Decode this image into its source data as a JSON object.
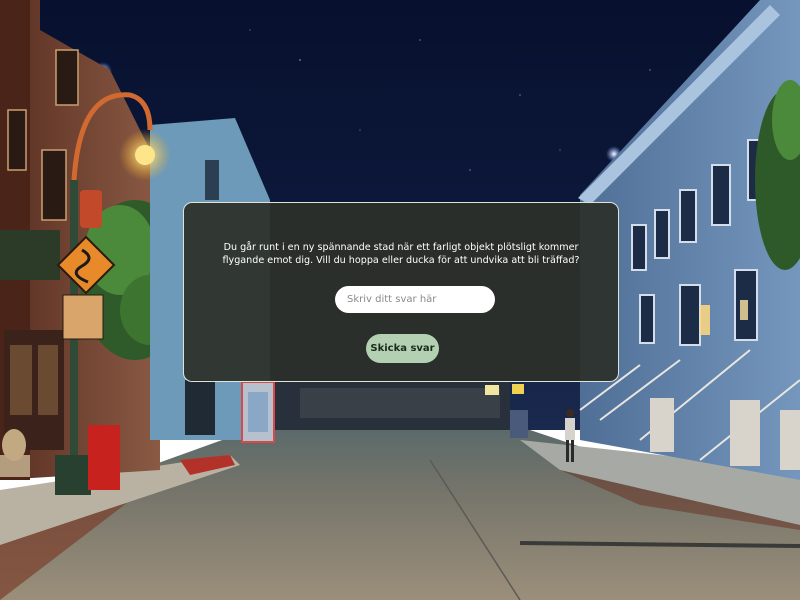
{
  "dialog": {
    "question": "Du går runt i en ny spännande stad när ett farligt objekt plötsligt kommer flygande emot dig. Vill du hoppa eller ducka för att undvika att bli träffad?",
    "answer_placeholder": "Skriv ditt svar här",
    "submit_label": "Skicka svar"
  },
  "colors": {
    "dialog_background": "#2c302a",
    "button_background": "#b4d0b2",
    "night_sky": "#0e1a3d"
  },
  "background_scene": {
    "description_icons": [
      "street-lamp-icon",
      "curvy-road-sign-icon",
      "phone-booth-icon",
      "fire-hydrant-icon",
      "lion-statue-icon"
    ]
  }
}
